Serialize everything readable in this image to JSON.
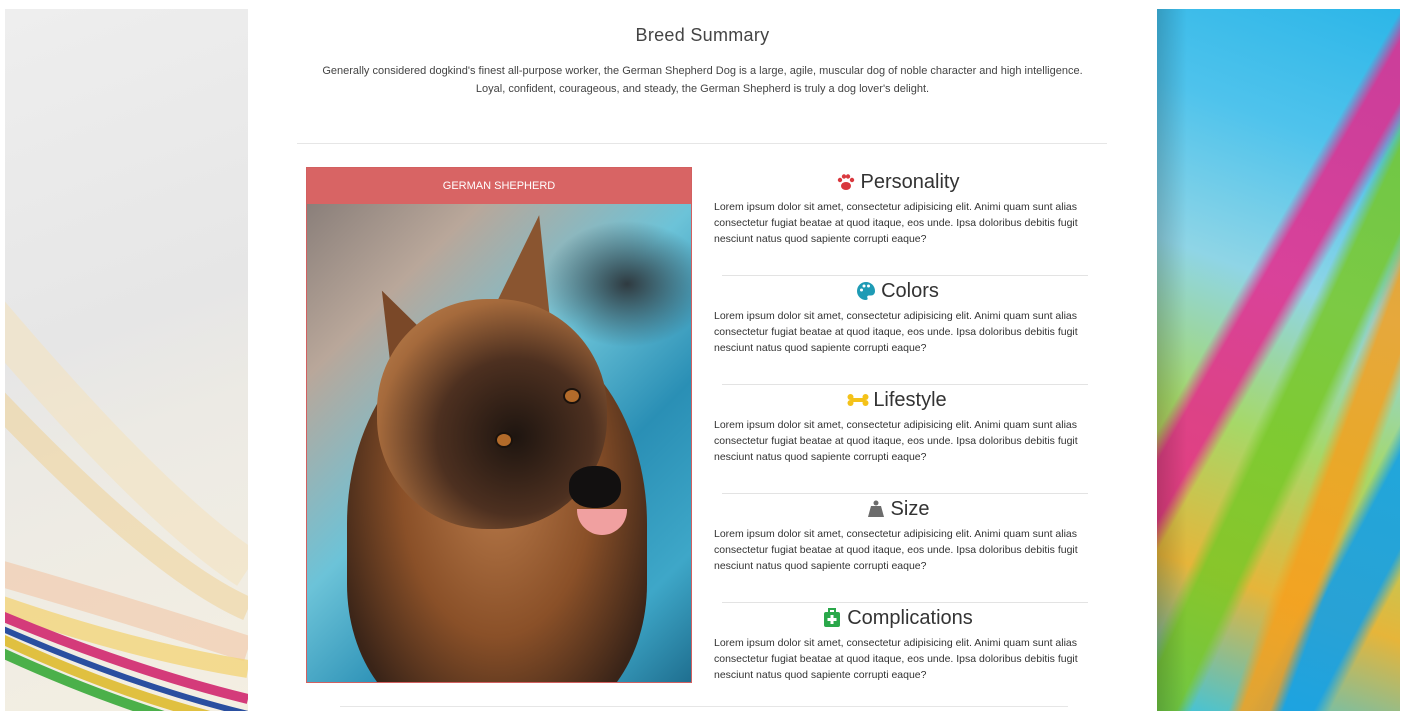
{
  "breed_summary": {
    "title": "Breed Summary",
    "text_line1": "Generally considered dogkind's finest all-purpose worker, the German Shepherd Dog is a large, agile, muscular dog of noble character and high intelligence.",
    "text_line2": "Loyal, confident, courageous, and steady, the German Shepherd is truly a dog lover's delight."
  },
  "card": {
    "header": "GERMAN SHEPHERD",
    "accent_color": "#d86464"
  },
  "sections": [
    {
      "title": "Personality",
      "icon": "paw-icon",
      "icon_color": "#d9383e",
      "text": "Lorem ipsum dolor sit amet, consectetur adipisicing elit. Animi quam sunt alias consectetur fugiat beatae at quod itaque, eos unde. Ipsa doloribus debitis fugit nesciunt natus quod sapiente corrupti eaque?"
    },
    {
      "title": "Colors",
      "icon": "palette-icon",
      "icon_color": "#1e9bb5",
      "text": "Lorem ipsum dolor sit amet, consectetur adipisicing elit. Animi quam sunt alias consectetur fugiat beatae at quod itaque, eos unde. Ipsa doloribus debitis fugit nesciunt natus quod sapiente corrupti eaque?"
    },
    {
      "title": "Lifestyle",
      "icon": "bone-icon",
      "icon_color": "#f4c219",
      "text": "Lorem ipsum dolor sit amet, consectetur adipisicing elit. Animi quam sunt alias consectetur fugiat beatae at quod itaque, eos unde. Ipsa doloribus debitis fugit nesciunt natus quod sapiente corrupti eaque?"
    },
    {
      "title": "Size",
      "icon": "weight-icon",
      "icon_color": "#6c6c6c",
      "text": "Lorem ipsum dolor sit amet, consectetur adipisicing elit. Animi quam sunt alias consectetur fugiat beatae at quod itaque, eos unde. Ipsa doloribus debitis fugit nesciunt natus quod sapiente corrupti eaque?"
    },
    {
      "title": "Complications",
      "icon": "medkit-icon",
      "icon_color": "#2aa84a",
      "text": "Lorem ipsum dolor sit amet, consectetur adipisicing elit. Animi quam sunt alias consectetur fugiat beatae at quod itaque, eos unde. Ipsa doloribus debitis fugit nesciunt natus quod sapiente corrupti eaque?"
    }
  ]
}
